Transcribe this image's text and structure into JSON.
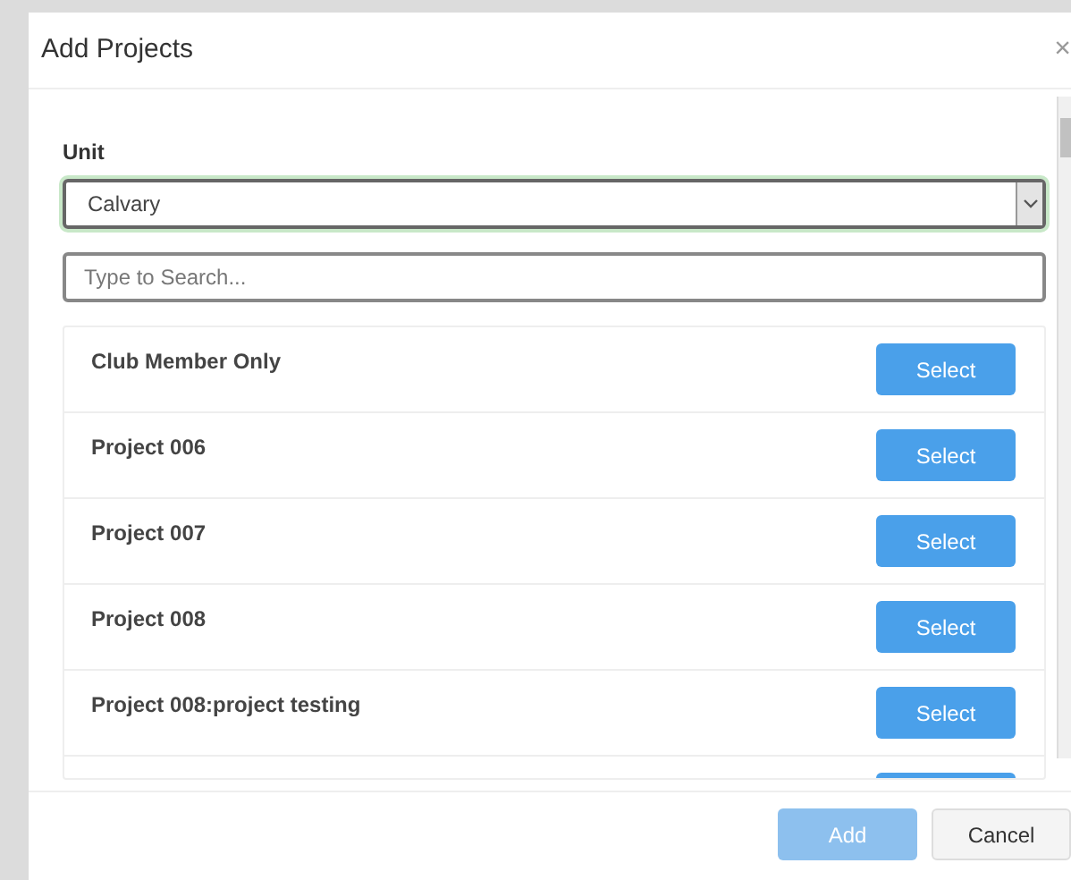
{
  "modal": {
    "title": "Add Projects",
    "close": "×"
  },
  "unit": {
    "label": "Unit",
    "value": "Calvary"
  },
  "search": {
    "placeholder": "Type to Search..."
  },
  "projects": [
    {
      "name": "Club Member Only",
      "action": "Select"
    },
    {
      "name": "Project 006",
      "action": "Select"
    },
    {
      "name": "Project 007",
      "action": "Select"
    },
    {
      "name": "Project 008",
      "action": "Select"
    },
    {
      "name": "Project 008:project testing",
      "action": "Select"
    }
  ],
  "footer": {
    "buttons": [
      {
        "label": "Add",
        "kind": "primary",
        "disabled": true
      },
      {
        "label": "Cancel",
        "kind": "secondary",
        "disabled": false
      }
    ]
  }
}
